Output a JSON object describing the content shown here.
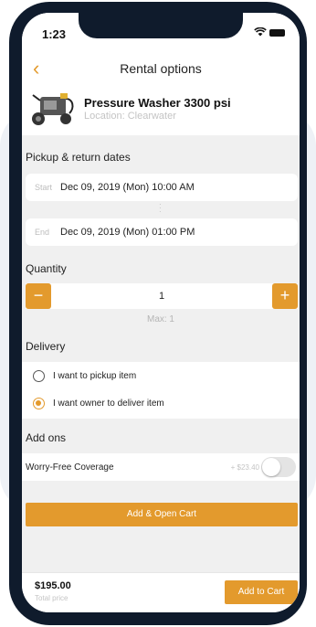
{
  "status": {
    "time": "1:23"
  },
  "nav": {
    "title": "Rental options"
  },
  "product": {
    "name": "Pressure Washer 3300 psi",
    "location": "Location: Clearwater"
  },
  "dates": {
    "section_label": "Pickup & return dates",
    "start_tag": "Start",
    "start_value": "Dec 09, 2019 (Mon) 10:00 AM",
    "end_tag": "End",
    "end_value": "Dec 09, 2019 (Mon) 01:00 PM"
  },
  "quantity": {
    "section_label": "Quantity",
    "value": "1",
    "max": "Max: 1"
  },
  "delivery": {
    "section_label": "Delivery",
    "options": [
      {
        "label": "I want to pickup item",
        "selected": false
      },
      {
        "label": "I want owner to deliver item",
        "selected": true
      }
    ]
  },
  "addons": {
    "section_label": "Add ons",
    "items": [
      {
        "label": "Worry-Free Coverage",
        "price": "+ $23.40",
        "enabled": false
      }
    ]
  },
  "buttons": {
    "open_cart": "Add & Open Cart",
    "add_to_cart": "Add to Cart"
  },
  "footer": {
    "total_price": "$195.00",
    "total_label": "Total price"
  },
  "colors": {
    "accent": "#e39a2d",
    "frame": "#0f1b2c"
  }
}
